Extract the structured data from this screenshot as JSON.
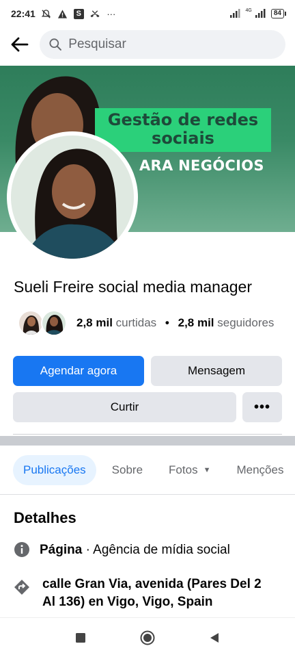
{
  "status_bar": {
    "time": "22:41",
    "icons": [
      "mute-bell-icon",
      "warning-icon",
      "s-app-icon",
      "missed-call-icon",
      "more-dots-icon"
    ],
    "more": "···",
    "network": "4G",
    "battery": "84"
  },
  "search": {
    "placeholder": "Pesquisar"
  },
  "cover": {
    "title": "Gestão de redes sociais",
    "subtitle": "ARA NEGÓCIOS",
    "colors": {
      "background": "#2e7d5a",
      "banner": "#2bd07a"
    }
  },
  "profile": {
    "name": "Sueli Freire social media manager",
    "likes_count": "2,8 mil",
    "likes_label": "curtidas",
    "separator": "•",
    "followers_count": "2,8 mil",
    "followers_label": "seguidores"
  },
  "actions": {
    "schedule": "Agendar agora",
    "message": "Mensagem",
    "like": "Curtir",
    "more": "•••"
  },
  "tabs": [
    {
      "label": "Publicações",
      "active": true
    },
    {
      "label": "Sobre",
      "active": false
    },
    {
      "label": "Fotos",
      "active": false
    },
    {
      "label": "Menções",
      "active": false
    }
  ],
  "details": {
    "title": "Detalhes",
    "category_label": "Página",
    "category_sep": " · ",
    "category_value": "Agência de mídia social",
    "address": "calle Gran Via, avenida (Pares Del 2 Al 136) en Vigo, Vigo, Spain"
  },
  "colors": {
    "accent": "#1877f2",
    "button_bg": "#e4e6eb",
    "tab_active_bg": "#e7f3ff"
  }
}
